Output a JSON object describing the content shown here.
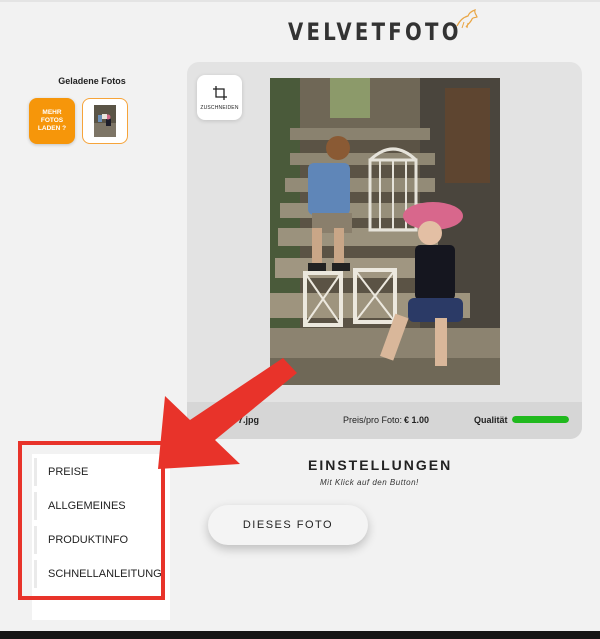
{
  "header": {
    "logo_text": "VELVETFOTO",
    "logo_icon": "horse-logo-icon"
  },
  "sidebar": {
    "title": "Geladene Fotos",
    "more_button": "MEHR FOTOS LADEN ?"
  },
  "editor": {
    "crop_label": "ZUSCHNEIDEN",
    "crop_icon": "crop-icon",
    "filename": "7.jpg",
    "price_label": "Preis/pro Foto:",
    "price_value": "€ 1.00",
    "quality_label": "Qualität",
    "quality_level": 1.0,
    "quality_color": "#20b91e"
  },
  "settings": {
    "title": "EINSTELLUNGEN",
    "subtitle": "Mit Klick auf den Button!",
    "button": "DIESES FOTO"
  },
  "menu": {
    "items": [
      "PREISE",
      "ALLGEMEINES",
      "PRODUKTINFO",
      "SCHNELLANLEITUNG"
    ]
  },
  "colors": {
    "accent": "#f6960a",
    "highlight": "#e8332a",
    "quality": "#20b91e"
  }
}
